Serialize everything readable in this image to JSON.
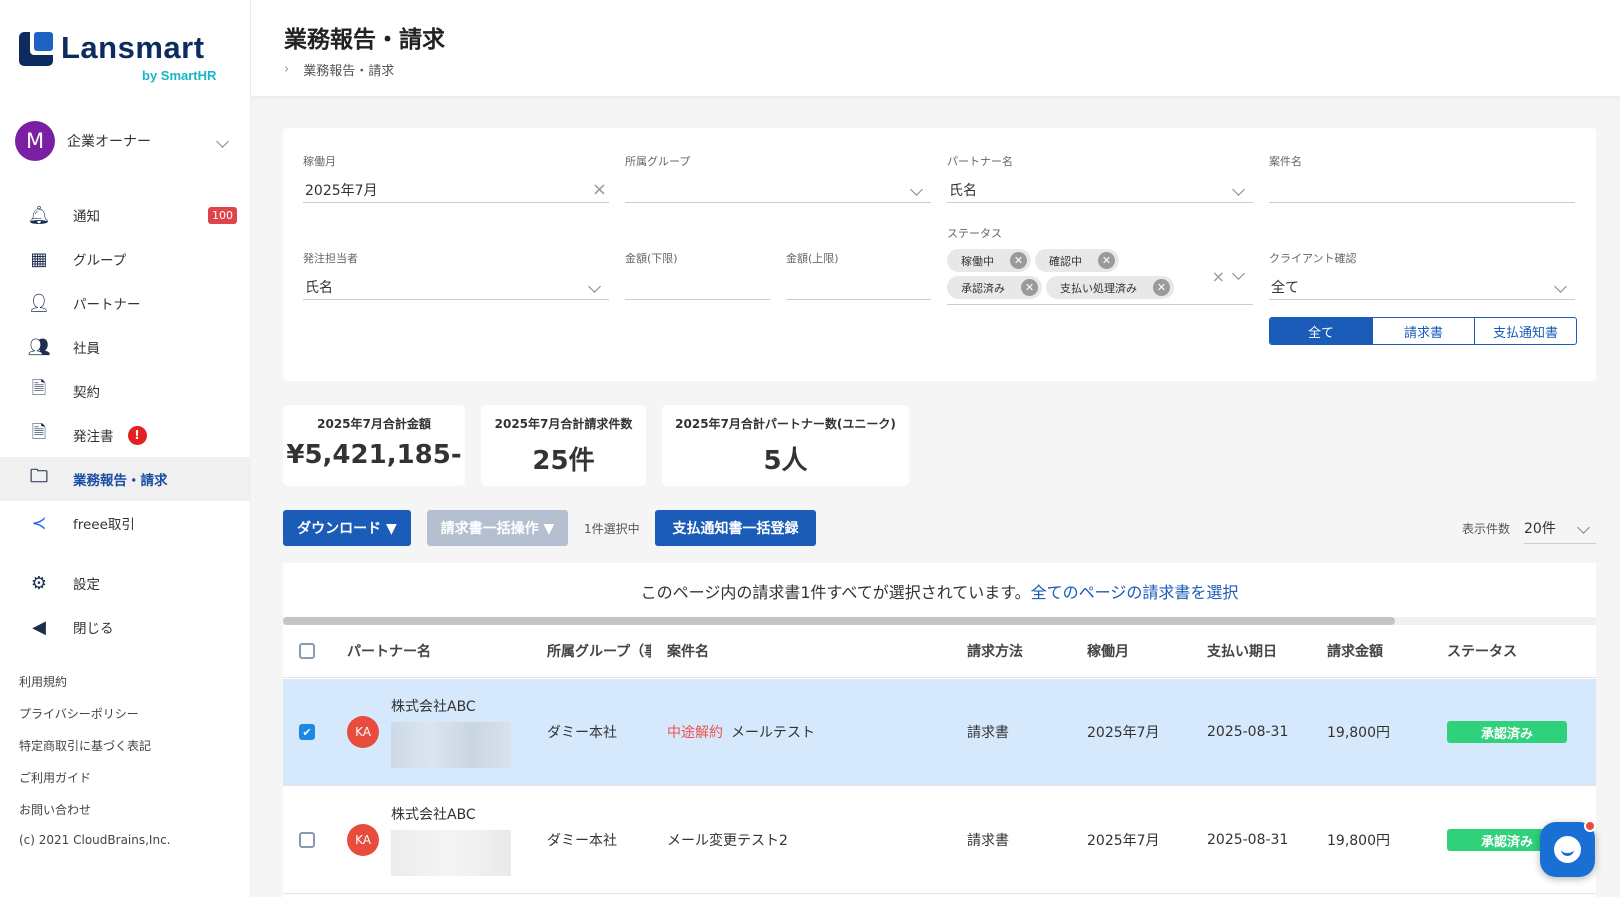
{
  "brand": {
    "name": "Lansmart",
    "by": "by SmartHR"
  },
  "user": {
    "initial": "M",
    "role": "企業オーナー"
  },
  "nav": [
    {
      "label": "通知",
      "badge": "100"
    },
    {
      "label": "グループ"
    },
    {
      "label": "パートナー"
    },
    {
      "label": "社員"
    },
    {
      "label": "契約"
    },
    {
      "label": "発注書",
      "alert": "!"
    },
    {
      "label": "業務報告・請求"
    },
    {
      "label": "freee取引"
    },
    {
      "label": "設定"
    },
    {
      "label": "閉じる"
    }
  ],
  "footer": [
    "利用規約",
    "プライバシーポリシー",
    "特定商取引に基づく表記",
    "ご利用ガイド",
    "お問い合わせ",
    "(c) 2021 CloudBrains,Inc."
  ],
  "header": {
    "title": "業務報告・請求",
    "breadcrumb": "業務報告・請求"
  },
  "filters": {
    "month": {
      "label": "稼働月",
      "value": "2025年7月"
    },
    "group": {
      "label": "所属グループ",
      "value": ""
    },
    "partner": {
      "label": "パートナー名",
      "value": "氏名"
    },
    "project": {
      "label": "案件名",
      "value": ""
    },
    "orderer": {
      "label": "発注担当者",
      "value": "氏名"
    },
    "amount_min": {
      "label": "金額(下限)",
      "value": ""
    },
    "amount_max": {
      "label": "金額(上限)",
      "value": ""
    },
    "status": {
      "label": "ステータス",
      "chips": [
        "稼働中",
        "確認中",
        "承認済み",
        "支払い処理済み"
      ]
    },
    "client": {
      "label": "クライアント確認",
      "value": "全て"
    },
    "doc_types": [
      "全て",
      "請求書",
      "支払通知書"
    ]
  },
  "stats": [
    {
      "label": "2025年7月合計金額",
      "value": "¥5,421,185-"
    },
    {
      "label": "2025年7月合計請求件数",
      "value": "25件"
    },
    {
      "label": "2025年7月合計パートナー数(ユニーク)",
      "value": "5人"
    }
  ],
  "actions": {
    "download": "ダウンロード ▼",
    "bulk": "請求書一括操作 ▼",
    "selected": "1件選択中",
    "register": "支払通知書一括登録",
    "per_page_label": "表示件数",
    "per_page": "20件"
  },
  "selection": {
    "message": "このページ内の請求書1件すべてが選択されています。",
    "link": "全てのページの請求書を選択"
  },
  "columns": [
    "パートナー名",
    "所属グループ（事",
    "案件名",
    "請求方法",
    "稼働月",
    "支払い期日",
    "請求金額",
    "ステータス"
  ],
  "rows": [
    {
      "selected": true,
      "initials": "KA",
      "company": "株式会社ABC",
      "group": "ダミー本社",
      "tag": "中途解約",
      "project": "メールテスト",
      "method": "請求書",
      "month": "2025年7月",
      "due": "2025-08-31",
      "amount": "19,800円",
      "status": "承認済み"
    },
    {
      "selected": false,
      "initials": "KA",
      "company": "株式会社ABC",
      "group": "ダミー本社",
      "tag": "",
      "project": "メール変更テスト2",
      "method": "請求書",
      "month": "2025年7月",
      "due": "2025-08-31",
      "amount": "19,800円",
      "status": "承認済み"
    }
  ],
  "colors": {
    "primary": "#1a5cb8",
    "approved": "#2fd27a",
    "danger": "#e0434b"
  }
}
